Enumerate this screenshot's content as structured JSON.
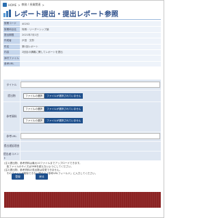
{
  "breadcrumb": {
    "items": [
      "HOME",
      ">",
      "教務 / 授業関連",
      ">"
    ]
  },
  "page": {
    "title": "レポート提出・提出レポート参照"
  },
  "info": [
    {
      "label": "授業コード",
      "value": "40202"
    },
    {
      "label": "授業科目名",
      "value": "特殊・リーダーシップ論"
    },
    {
      "label": "提出期限",
      "value": "2021年7月1日"
    },
    {
      "label": "作成者",
      "value": "戸田　文彰"
    },
    {
      "label": "件名",
      "value": "第1回レポート"
    },
    {
      "label": "内容",
      "value": "2回目の講義に関してレポートを提出"
    },
    {
      "label": "添付ファイル",
      "value": ""
    },
    {
      "label": "参考URL",
      "value": ""
    }
  ],
  "form": {
    "title_label": "タイトル",
    "submit_file_label": "提出物",
    "reference_file_label": "参考資料",
    "reference_url_label": "参考URL",
    "late_reason_label": "提出遅延理由",
    "comment_label": "提出者コメント",
    "file_button_label": "ファイルの選択",
    "file_status_none": "ファイルが選択されていません",
    "file_status_none_alt": "ファイルが選択されていません"
  },
  "notes": [
    "(注1)提出物、参考資料は最大10ファイルまでアップロードできます。",
    "　各ファイルのサイズは3MBを超えないようにしてください。",
    "(注2)提出物、参考資料の見出数は変更できません。",
    "　そのファイルが削除できない場合は「参考URLフィールド」に入力してください。"
  ],
  "buttons": {
    "submit": "登録",
    "back": "戻る"
  },
  "colors": {
    "accent": "#1e4f8c",
    "footer": "#8b2323",
    "label_bg": "#c5d6ec",
    "value_bg": "#eef3fa"
  }
}
